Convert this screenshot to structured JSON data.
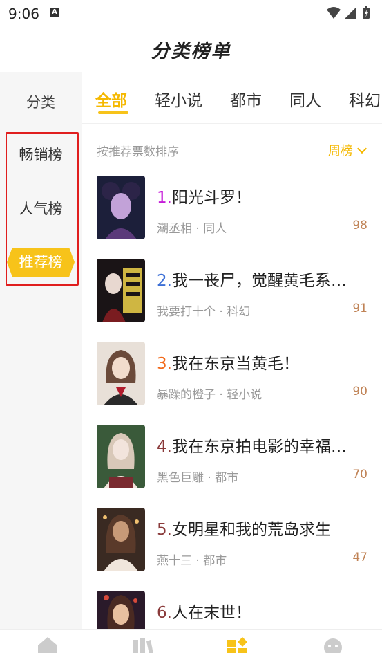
{
  "status_bar": {
    "time": "9:06",
    "notification_glyph": "A"
  },
  "header": {
    "title": "分类榜单"
  },
  "sidebar": {
    "header_label": "分类",
    "items": [
      {
        "label": "畅销榜",
        "active": false
      },
      {
        "label": "人气榜",
        "active": false
      },
      {
        "label": "推荐榜",
        "active": true
      }
    ]
  },
  "tabs": [
    {
      "label": "全部",
      "active": true
    },
    {
      "label": "轻小说",
      "active": false
    },
    {
      "label": "都市",
      "active": false
    },
    {
      "label": "同人",
      "active": false
    },
    {
      "label": "科幻",
      "active": false
    }
  ],
  "sort": {
    "label": "按推荐票数排序",
    "period": "周榜"
  },
  "books": [
    {
      "rank": "1.",
      "rank_color": "#c51cd8",
      "title": "阳光斗罗！",
      "author": "潮丞相",
      "category": "同人",
      "score": "98",
      "cover_colors": [
        "#1c1f3a",
        "#5b3a7a",
        "#c2a2d8"
      ]
    },
    {
      "rank": "2.",
      "rank_color": "#3c6fd6",
      "title": "我一丧尸，觉醒黄毛系…",
      "author": "我要打十个",
      "category": "科幻",
      "score": "91",
      "cover_colors": [
        "#1a1416",
        "#7a1c20",
        "#f0d24a"
      ]
    },
    {
      "rank": "3.",
      "rank_color": "#f26a1b",
      "title": "我在东京当黄毛！",
      "author": "暴躁的橙子",
      "category": "轻小说",
      "score": "90",
      "cover_colors": [
        "#e8e0d8",
        "#6b4a3a",
        "#b01c2c"
      ]
    },
    {
      "rank": "4.",
      "rank_color": "#8a3a3a",
      "title": "我在东京拍电影的幸福…",
      "author": "黑色巨雕",
      "category": "都市",
      "score": "70",
      "cover_colors": [
        "#3a5a3a",
        "#f2e4dc",
        "#7a2a30"
      ]
    },
    {
      "rank": "5.",
      "rank_color": "#8a3a3a",
      "title": "女明星和我的荒岛求生",
      "author": "燕十三",
      "category": "都市",
      "score": "47",
      "cover_colors": [
        "#3a2a22",
        "#c79a78",
        "#f0e6dc"
      ]
    },
    {
      "rank": "6.",
      "rank_color": "#8a3a3a",
      "title": "人在末世！",
      "author": "",
      "category": "",
      "score": "",
      "cover_colors": [
        "#2a1a2a",
        "#d84a3a",
        "#e8c0a0"
      ]
    }
  ],
  "bottom_nav": [
    {
      "icon": "home-icon",
      "active": false,
      "color": "#cccccc"
    },
    {
      "icon": "bookshelf-icon",
      "active": false,
      "color": "#cccccc"
    },
    {
      "icon": "category-icon",
      "active": true,
      "color": "#f7c31a"
    },
    {
      "icon": "profile-icon",
      "active": false,
      "color": "#cccccc"
    }
  ],
  "colors": {
    "accent": "#f7c31a",
    "accent_text": "#f5b800",
    "highlight_box": "#e01e1e",
    "score": "#c08356"
  }
}
